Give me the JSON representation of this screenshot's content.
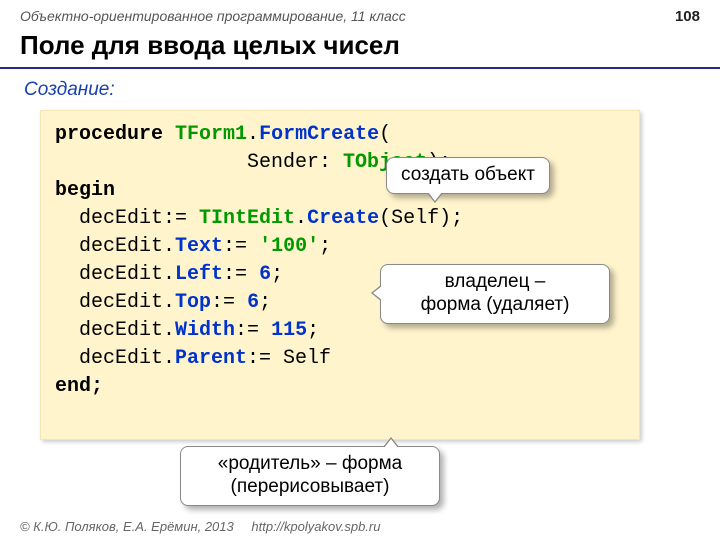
{
  "header": {
    "context": "Объектно-ориентированное программирование, 11 класс",
    "page_number": "108"
  },
  "title": "Поле для ввода целых чисел",
  "subtitle": "Создание:",
  "code": {
    "l1_kw": "procedure ",
    "l1_type": "TForm1",
    "l1_dot": ".",
    "l1_member": "FormCreate",
    "l1_open": "(",
    "l2_indent": "                Sender: ",
    "l2_type": "TObject",
    "l2_close": ");",
    "l3": "begin",
    "l4_pre": "  decEdit:= ",
    "l4_type": "TIntEdit",
    "l4_dot": ".",
    "l4_member": "Create",
    "l4_post": "(Self);",
    "l5_pre": "  decEdit.",
    "l5_member": "Text",
    "l5_mid": ":= ",
    "l5_str": "'100'",
    "l5_end": ";",
    "l6_pre": "  decEdit.",
    "l6_member": "Left",
    "l6_mid": ":= ",
    "l6_num": "6",
    "l6_end": ";",
    "l7_pre": "  decEdit.",
    "l7_member": "Top",
    "l7_mid": ":= ",
    "l7_num": "6",
    "l7_end": ";",
    "l8_pre": "  decEdit.",
    "l8_member": "Width",
    "l8_mid": ":= ",
    "l8_num": "115",
    "l8_end": ";",
    "l9_pre": "  decEdit.",
    "l9_member": "Parent",
    "l9_mid": ":= Self",
    "l10": "end;"
  },
  "callouts": {
    "create": "создать объект",
    "owner_l1": "владелец –",
    "owner_l2": "форма (удаляет)",
    "parent_l1": "«родитель» – форма",
    "parent_l2": "(перерисовывает)"
  },
  "footer": {
    "copyright": "© К.Ю. Поляков, Е.А. Ерёмин, 2013",
    "url": "http://kpolyakov.spb.ru"
  }
}
